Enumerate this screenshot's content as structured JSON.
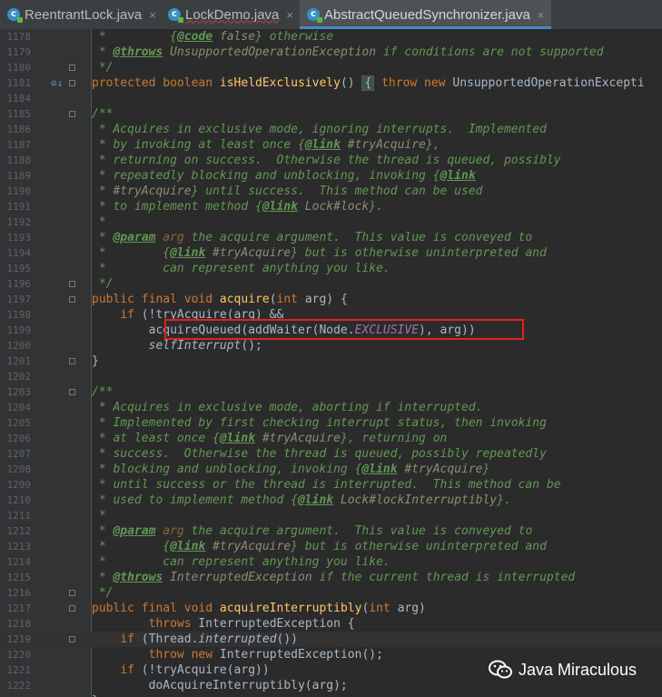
{
  "tabs": [
    {
      "label": "ReentrantLock.java",
      "close": "×",
      "active": false,
      "squiggle": false
    },
    {
      "label": "LockDemo.java",
      "close": "×",
      "active": false,
      "squiggle": true
    },
    {
      "label": "AbstractQueuedSynchronizer.java",
      "close": "×",
      "active": true,
      "squiggle": false
    }
  ],
  "file_icon_letter": "c",
  "colors": {
    "background": "#2b2b2b",
    "keyword": "#cc7832",
    "comment": "#629755",
    "method": "#ffc66d",
    "constant": "#9876aa",
    "highlight": "#e62020"
  },
  "lines": [
    {
      "n": "1178",
      "segs": [
        [
          "cm",
          " * "
        ],
        [
          "cm",
          "        {"
        ],
        [
          "tag",
          "@code"
        ],
        [
          "cref",
          " false"
        ],
        [
          "cm",
          "} otherwise"
        ]
      ]
    },
    {
      "n": "1179",
      "segs": [
        [
          "cm",
          " * "
        ],
        [
          "tag",
          "@throws"
        ],
        [
          "cref",
          " UnsupportedOperationException"
        ],
        [
          "cm",
          " if conditions are not supported"
        ]
      ]
    },
    {
      "n": "1180",
      "segs": [
        [
          "cm",
          " */"
        ]
      ]
    },
    {
      "n": "1181",
      "segs": [
        [
          "kw",
          "protected boolean "
        ],
        [
          "fn",
          "isHeldExclusively"
        ],
        [
          "",
          "() "
        ],
        [
          "box",
          "{"
        ],
        [
          "",
          " "
        ],
        [
          "kw",
          "throw new "
        ],
        [
          "",
          "UnsupportedOperationExcepti"
        ]
      ]
    },
    {
      "n": "1184",
      "segs": []
    },
    {
      "n": "1185",
      "segs": [
        [
          "cm",
          "/**"
        ]
      ]
    },
    {
      "n": "1186",
      "segs": [
        [
          "cm",
          " * Acquires in exclusive mode, ignoring interrupts.  Implemented"
        ]
      ]
    },
    {
      "n": "1187",
      "segs": [
        [
          "cm",
          " * by invoking at least once {"
        ],
        [
          "tag",
          "@link"
        ],
        [
          "cref",
          " #tryAcquire"
        ],
        [
          "cm",
          "},"
        ]
      ]
    },
    {
      "n": "1188",
      "segs": [
        [
          "cm",
          " * returning on success.  Otherwise the thread is queued, possibly"
        ]
      ]
    },
    {
      "n": "1189",
      "segs": [
        [
          "cm",
          " * repeatedly blocking and unblocking, invoking {"
        ],
        [
          "tag",
          "@link"
        ]
      ]
    },
    {
      "n": "1190",
      "segs": [
        [
          "cm",
          " * "
        ],
        [
          "cref",
          "#tryAcquire"
        ],
        [
          "cm",
          "} until success.  This method can be used"
        ]
      ]
    },
    {
      "n": "1191",
      "segs": [
        [
          "cm",
          " * to implement method {"
        ],
        [
          "tag",
          "@link"
        ],
        [
          "cref",
          " Lock#lock"
        ],
        [
          "cm",
          "}."
        ]
      ]
    },
    {
      "n": "1192",
      "segs": [
        [
          "cm",
          " *"
        ]
      ]
    },
    {
      "n": "1193",
      "segs": [
        [
          "cm",
          " * "
        ],
        [
          "tag",
          "@param"
        ],
        [
          "pn",
          " arg"
        ],
        [
          "cm",
          " the acquire argument.  This value is conveyed to"
        ]
      ]
    },
    {
      "n": "1194",
      "segs": [
        [
          "cm",
          " *        {"
        ],
        [
          "tag",
          "@link"
        ],
        [
          "cref",
          " #tryAcquire"
        ],
        [
          "cm",
          "} but is otherwise uninterpreted and"
        ]
      ]
    },
    {
      "n": "1195",
      "segs": [
        [
          "cm",
          " *        can represent anything you like."
        ]
      ]
    },
    {
      "n": "1196",
      "segs": [
        [
          "cm",
          " */"
        ]
      ]
    },
    {
      "n": "1197",
      "segs": [
        [
          "kw",
          "public final void "
        ],
        [
          "fn",
          "acquire"
        ],
        [
          "",
          "("
        ],
        [
          "kw",
          "int "
        ],
        [
          "",
          "arg) {"
        ]
      ]
    },
    {
      "n": "1198",
      "segs": [
        [
          "",
          "    "
        ],
        [
          "kw",
          "if "
        ],
        [
          "",
          "(!tryAcquire(arg) &&"
        ]
      ]
    },
    {
      "n": "1199",
      "segs": [
        [
          "",
          "        acquireQueued(addWaiter(Node."
        ],
        [
          "cst",
          "EXCLUSIVE"
        ],
        [
          "",
          "), arg))"
        ]
      ]
    },
    {
      "n": "1200",
      "segs": [
        [
          "",
          "        "
        ],
        [
          "it",
          "selfInterrupt"
        ],
        [
          "",
          "();"
        ]
      ]
    },
    {
      "n": "1201",
      "segs": [
        [
          "",
          "}"
        ]
      ]
    },
    {
      "n": "1202",
      "segs": []
    },
    {
      "n": "1203",
      "segs": [
        [
          "cm",
          "/**"
        ]
      ]
    },
    {
      "n": "1204",
      "segs": [
        [
          "cm",
          " * Acquires in exclusive mode, aborting if interrupted."
        ]
      ]
    },
    {
      "n": "1205",
      "segs": [
        [
          "cm",
          " * Implemented by first checking interrupt status, then invoking"
        ]
      ]
    },
    {
      "n": "1206",
      "segs": [
        [
          "cm",
          " * at least once {"
        ],
        [
          "tag",
          "@link"
        ],
        [
          "cref",
          " #tryAcquire"
        ],
        [
          "cm",
          "}, returning on"
        ]
      ]
    },
    {
      "n": "1207",
      "segs": [
        [
          "cm",
          " * success.  Otherwise the thread is queued, possibly repeatedly"
        ]
      ]
    },
    {
      "n": "1208",
      "segs": [
        [
          "cm",
          " * blocking and unblocking, invoking {"
        ],
        [
          "tag",
          "@link"
        ],
        [
          "cref",
          " #tryAcquire"
        ],
        [
          "cm",
          "}"
        ]
      ]
    },
    {
      "n": "1209",
      "segs": [
        [
          "cm",
          " * until success or the thread is interrupted.  This method can be"
        ]
      ]
    },
    {
      "n": "1210",
      "segs": [
        [
          "cm",
          " * used to implement method {"
        ],
        [
          "tag",
          "@link"
        ],
        [
          "cref",
          " Lock#lockInterruptibly"
        ],
        [
          "cm",
          "}."
        ]
      ]
    },
    {
      "n": "1211",
      "segs": [
        [
          "cm",
          " *"
        ]
      ]
    },
    {
      "n": "1212",
      "segs": [
        [
          "cm",
          " * "
        ],
        [
          "tag",
          "@param"
        ],
        [
          "pn",
          " arg"
        ],
        [
          "cm",
          " the acquire argument.  This value is conveyed to"
        ]
      ]
    },
    {
      "n": "1213",
      "segs": [
        [
          "cm",
          " *        {"
        ],
        [
          "tag",
          "@link"
        ],
        [
          "cref",
          " #tryAcquire"
        ],
        [
          "cm",
          "} but is otherwise uninterpreted and"
        ]
      ]
    },
    {
      "n": "1214",
      "segs": [
        [
          "cm",
          " *        can represent anything you like."
        ]
      ]
    },
    {
      "n": "1215",
      "segs": [
        [
          "cm",
          " * "
        ],
        [
          "tag",
          "@throws"
        ],
        [
          "cref",
          " InterruptedException"
        ],
        [
          "cm",
          " if the current thread is interrupted"
        ]
      ]
    },
    {
      "n": "1216",
      "segs": [
        [
          "cm",
          " */"
        ]
      ]
    },
    {
      "n": "1217",
      "segs": [
        [
          "kw",
          "public final void "
        ],
        [
          "fn",
          "acquireInterruptibly"
        ],
        [
          "",
          "("
        ],
        [
          "kw",
          "int "
        ],
        [
          "",
          "arg)"
        ]
      ]
    },
    {
      "n": "1218",
      "segs": [
        [
          "",
          "        "
        ],
        [
          "kw",
          "throws "
        ],
        [
          "",
          "InterruptedException {"
        ]
      ]
    },
    {
      "n": "1219",
      "segs": [
        [
          "",
          "    "
        ],
        [
          "kw",
          "if "
        ],
        [
          "",
          "(Thread."
        ],
        [
          "it",
          "interrupted"
        ],
        [
          "",
          "())"
        ]
      ]
    },
    {
      "n": "1220",
      "segs": [
        [
          "",
          "        "
        ],
        [
          "kw",
          "throw new "
        ],
        [
          "",
          "InterruptedException();"
        ]
      ]
    },
    {
      "n": "1221",
      "segs": [
        [
          "",
          "    "
        ],
        [
          "kw",
          "if "
        ],
        [
          "",
          "(!tryAcquire(arg))"
        ]
      ]
    },
    {
      "n": "1222",
      "segs": [
        [
          "",
          "        doAcquireInterruptibly(arg);"
        ]
      ]
    },
    {
      "n": "",
      "segs": [
        [
          "",
          "}"
        ]
      ]
    }
  ],
  "watermark": {
    "text": "Java Miraculous",
    "icon": "wechat-icon"
  }
}
